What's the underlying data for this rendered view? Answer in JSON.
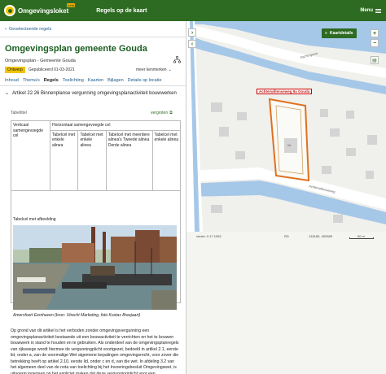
{
  "header": {
    "logo_text": "Omgevingsloket",
    "logo_badge": "beta",
    "app_title": "Regels op de kaart",
    "menu_label": "Menu"
  },
  "panel": {
    "back_label": "Geselecteerde regels",
    "title": "Omgevingsplan gemeente Gouda",
    "subtitle": "Omgevingsplan - Gemeente Gouda",
    "status_badge": "Ontwerp",
    "published": "Gepubliceerd 01-03-2021",
    "more_label": "meer kenmerken",
    "tabs": [
      {
        "label": "Inhoud"
      },
      {
        "label": "Thema's"
      },
      {
        "label": "Regels"
      },
      {
        "label": "Toelichting"
      },
      {
        "label": "Kaarten"
      },
      {
        "label": "Bijlagen"
      },
      {
        "label": "Details op locatie"
      }
    ],
    "article_title": "Artikel 22.26 Binnenplanse vergunning omgevingsplanactiviteit bouwwerken",
    "table_label": "Tabeltitel",
    "enlarge_label": "vergroten",
    "table": {
      "vertical_header": "Verticaal samengevoegde cel",
      "horizontal_header": "Horizontaal samengevoegde cel",
      "cells": [
        "Tabelcel met enkele alinea",
        "Tabelcel met enkele alinea",
        "Tabelcel met meerdere alinea's Tweede alinea Derde alinea",
        "Tabelcel met enkele alinea"
      ],
      "image_cell_label": "Tabelcel met afbeelding"
    },
    "photo_caption": "Amersfoort Eemhaven (bron: Utrecht Marketing, foto Kostas Breejaart)",
    "body": "Op grond van dit artikel is het verboden zonder omgevingsvergunning een omgevingsplanactiviteit bestaande uit een bouwactiviteit te verrichten en het te bouwen bouwwerk in stand te houden en te gebruiken. Als onderdeel van de omgevingsplanregels van rijkswege wordt hiermee de vergunningplicht voortgezet, bedoeld in artikel 2.1, eerste lid, onder a, van de voormalige Wet algemene bepalingen omgevingsrecht, voor zover die betrekking heeft op artikel 2.10, eerste lid, onder c en d, van die wet. In afdeling 3.2 van het algemeen deel van de nota van toelichting bij het Invoeringsbesluit Omgevingswet, is uitvoerig ingegaan op het expliciet maken dat deze vergunningplicht voor een"
  },
  "map": {
    "kaart_button": "Kaartdetails",
    "location_label": "Achterwillenseweg 9a Gouda",
    "street_1": "Aschergouw",
    "street_2": "Achterwillenseweg",
    "house_number": "9A",
    "scale_left": "versie: 0.17.1052",
    "scale_mid": "RD",
    "coords": "133180, 453385",
    "scale_text": "50 m",
    "colors": {
      "water": "#a6c8e8",
      "road": "#ffffff",
      "building": "#d4d4d4",
      "accent": "#2e6b22",
      "selection": "#e07020"
    }
  }
}
